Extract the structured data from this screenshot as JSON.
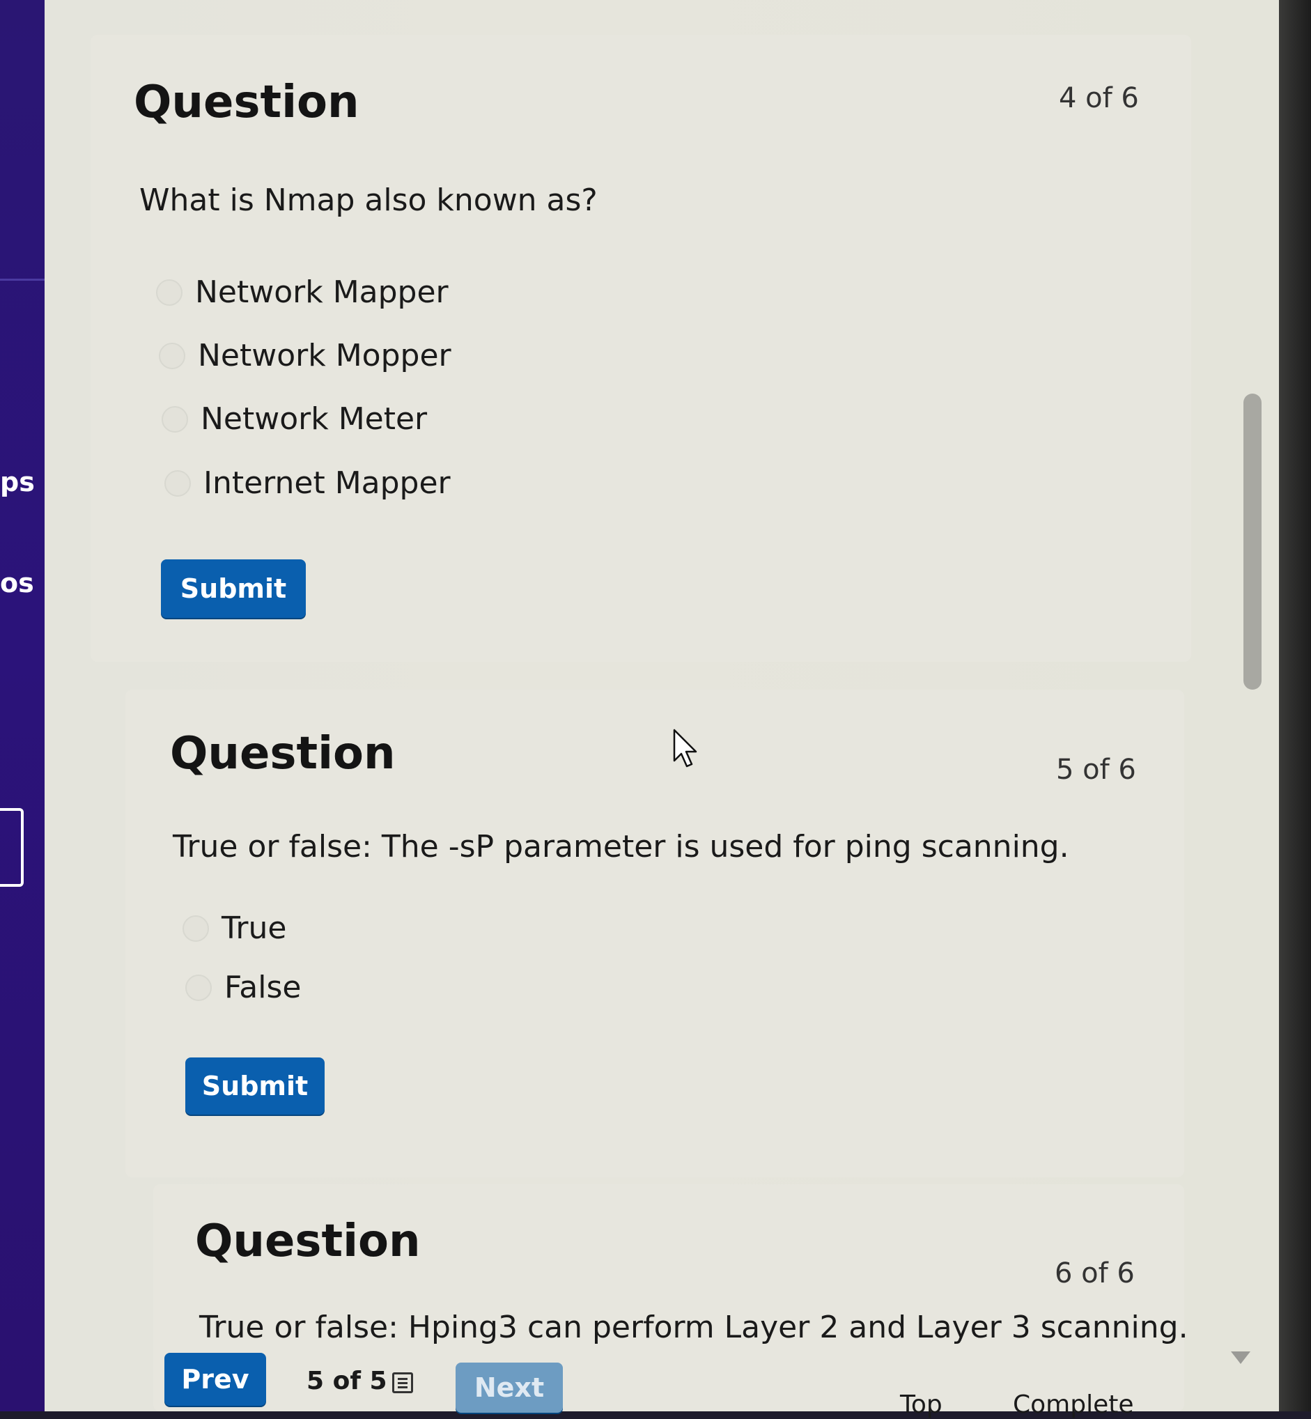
{
  "sidebar": {
    "labels": [
      "ps",
      "os"
    ]
  },
  "questions": [
    {
      "title": "Question",
      "counter": "4 of 6",
      "text": "What is Nmap also known as?",
      "options": [
        "Network Mapper",
        "Network Mopper",
        "Network Meter",
        "Internet Mapper"
      ],
      "submit_label": "Submit"
    },
    {
      "title": "Question",
      "counter": "5 of 6",
      "text": "True or false: The -sP parameter is used for ping scanning.",
      "options": [
        "True",
        "False"
      ],
      "submit_label": "Submit"
    },
    {
      "title": "Question",
      "counter": "6 of 6",
      "text": "True or false: Hping3 can perform Layer 2 and Layer 3 scanning."
    }
  ],
  "pager": {
    "prev_label": "Prev",
    "status": "5 of 5",
    "next_label": "Next",
    "icons": {
      "list": "list-icon",
      "cursor": "mouse-pointer-icon",
      "scroll_down": "chevron-down-icon"
    }
  },
  "footer": {
    "top_label": "Top",
    "complete_label": "Complete"
  }
}
